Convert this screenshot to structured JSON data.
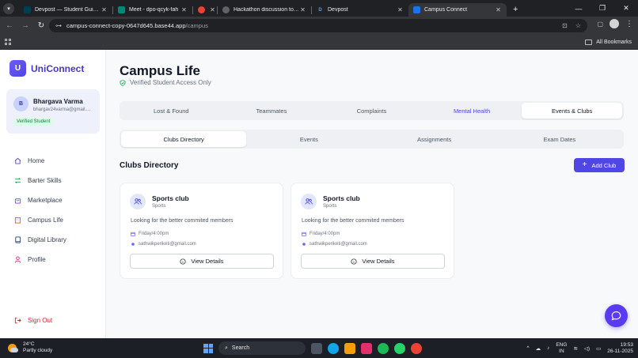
{
  "browser": {
    "tabs": [
      {
        "title": "Devpost — Student Guide for H",
        "favicon_color": "#003e54",
        "favicon_letter": ""
      },
      {
        "title": "Meet - dpo-qcyk-fah",
        "favicon_color": "#00897b",
        "favicon_letter": ""
      },
      {
        "title": "",
        "favicon_color": "#ea4335",
        "favicon_letter": ""
      },
      {
        "title": "Hackathon discussion topics",
        "favicon_color": "#5f6368",
        "favicon_letter": ""
      },
      {
        "title": "Devpost",
        "favicon_color": "#003e54",
        "favicon_letter": "D"
      },
      {
        "title": "Campus Connect",
        "favicon_color": "#1a73e8",
        "favicon_letter": ""
      }
    ],
    "active_tab_index": 5,
    "url_host": "campus-connect-copy-0647d645.base44.app",
    "url_path": "/campus",
    "all_bookmarks_label": "All Bookmarks"
  },
  "app": {
    "brand_letter": "U",
    "brand_name": "UniConnect",
    "user": {
      "initial": "B",
      "name": "Bhargava Varma",
      "email": "bhargav24varma@gmail....",
      "badge": "Verified Student"
    },
    "nav": [
      {
        "label": "Home",
        "icon": "home-icon"
      },
      {
        "label": "Barter Skills",
        "icon": "swap-icon"
      },
      {
        "label": "Marketplace",
        "icon": "shopping-bag-icon"
      },
      {
        "label": "Campus Life",
        "icon": "building-icon"
      },
      {
        "label": "Digital Library",
        "icon": "book-icon"
      },
      {
        "label": "Profile",
        "icon": "user-icon"
      }
    ],
    "signout_label": "Sign Out",
    "colors": {
      "accent": "#4f46e5",
      "danger": "#dc2626",
      "success": "#15803d"
    }
  },
  "page": {
    "title": "Campus Life",
    "subtitle": "Verified Student Access Only",
    "main_tabs": [
      {
        "label": "Lost & Found"
      },
      {
        "label": "Teammates"
      },
      {
        "label": "Complaints"
      },
      {
        "label": "Mental Health"
      },
      {
        "label": "Events & Clubs"
      }
    ],
    "active_main_tab": "Events & Clubs",
    "sub_tabs": [
      {
        "label": "Clubs Directory"
      },
      {
        "label": "Events"
      },
      {
        "label": "Assignments"
      },
      {
        "label": "Exam Dates"
      }
    ],
    "active_sub_tab": "Clubs Directory",
    "section_title": "Clubs Directory",
    "add_button_label": "Add Club",
    "clubs": [
      {
        "name": "Sports club",
        "category": "Sports",
        "description": "Looking for the better commited members",
        "schedule": "Friday/4:00pm",
        "contact": "sathwikperiketi@gmail.com",
        "button": "View Details"
      },
      {
        "name": "Sports club",
        "category": "Sports",
        "description": "Looking for the better commited members",
        "schedule": "Friday/4:00pm",
        "contact": "sathwikperiketi@gmail.com",
        "button": "View Details"
      }
    ]
  },
  "taskbar": {
    "weather_temp": "24°C",
    "weather_desc": "Partly cloudy",
    "search_label": "Search",
    "lang_top": "ENG",
    "lang_bottom": "IN",
    "time": "19:53",
    "date": "26-11-2025"
  }
}
